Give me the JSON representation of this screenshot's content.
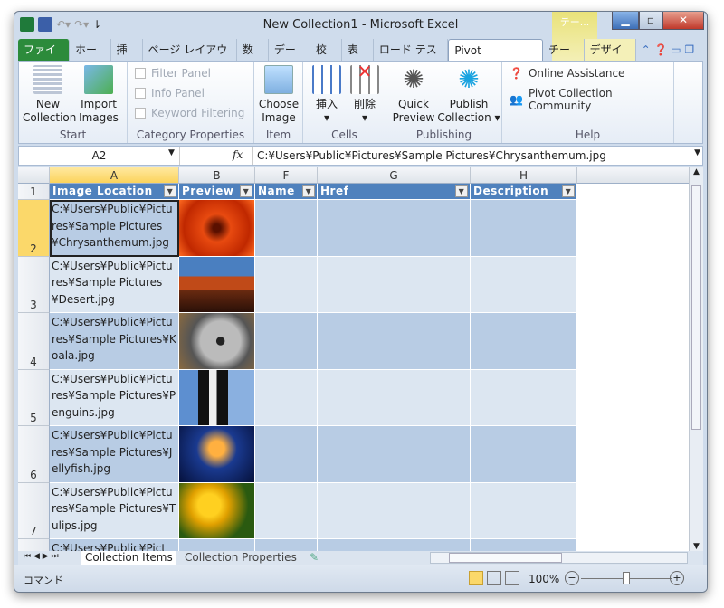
{
  "window": {
    "title": "New Collection1  -  Microsoft Excel",
    "context_tab": "テー...",
    "context_subtab": "デザイン"
  },
  "tabs": [
    {
      "label": "ファイル"
    },
    {
      "label": "ホーム"
    },
    {
      "label": "挿入"
    },
    {
      "label": "ページ レイアウト"
    },
    {
      "label": "数式"
    },
    {
      "label": "データ"
    },
    {
      "label": "校閲"
    },
    {
      "label": "表示"
    },
    {
      "label": "ロード テスト"
    },
    {
      "label": "Pivot Collections"
    },
    {
      "label": "チーム"
    }
  ],
  "ribbon": {
    "start": {
      "label": "Start",
      "new": "New\nCollection",
      "import": "Import\nImages"
    },
    "category": {
      "label": "Category Properties",
      "filter": "Filter Panel",
      "info": "Info Panel",
      "keyword": "Keyword Filtering"
    },
    "item": {
      "label": "Item",
      "choose": "Choose\nImage"
    },
    "cells": {
      "label": "Cells",
      "insert": "挿入",
      "delete": "削除"
    },
    "publishing": {
      "label": "Publishing",
      "quick": "Quick\nPreview",
      "publish": "Publish\nCollection ▾"
    },
    "help": {
      "label": "Help",
      "online": "Online Assistance",
      "community": "Pivot Collection Community"
    }
  },
  "formula": {
    "name_box": "A2",
    "fx": "fx",
    "value": "C:¥Users¥Public¥Pictures¥Sample Pictures¥Chrysanthemum.jpg"
  },
  "columns": [
    "A",
    "B",
    "F",
    "G",
    "H"
  ],
  "headers": [
    "Image Location",
    "Preview",
    "Name",
    "Href",
    "Description"
  ],
  "rows": [
    {
      "num": "1"
    },
    {
      "num": "2",
      "path": "C:¥Users¥Public¥Pictures¥Sample Pictures¥Chrysanthemum.jpg",
      "img": "chrysanthemum"
    },
    {
      "num": "3",
      "path": "C:¥Users¥Public¥Pictures¥Sample Pictures¥Desert.jpg",
      "img": "desert"
    },
    {
      "num": "4",
      "path": "C:¥Users¥Public¥Pictures¥Sample Pictures¥Koala.jpg",
      "img": "koala"
    },
    {
      "num": "5",
      "path": "C:¥Users¥Public¥Pictures¥Sample Pictures¥Penguins.jpg",
      "img": "penguins"
    },
    {
      "num": "6",
      "path": "C:¥Users¥Public¥Pictures¥Sample Pictures¥Jellyfish.jpg",
      "img": "jellyfish"
    },
    {
      "num": "7",
      "path": "C:¥Users¥Public¥Pictures¥Sample Pictures¥Tulips.jpg",
      "img": "tulips"
    },
    {
      "num": "",
      "path": "C:¥Users¥Public¥Pict",
      "img": ""
    }
  ],
  "sheets": [
    "Collection Items",
    "Collection Properties"
  ],
  "status": {
    "mode": "コマンド",
    "zoom": "100%",
    "zoom_level_percent": 100
  },
  "colors": {
    "header": "#4f81bd",
    "band_dark": "#b8cce4",
    "band_light": "#dce6f1",
    "file_tab": "#2c8b3b"
  }
}
